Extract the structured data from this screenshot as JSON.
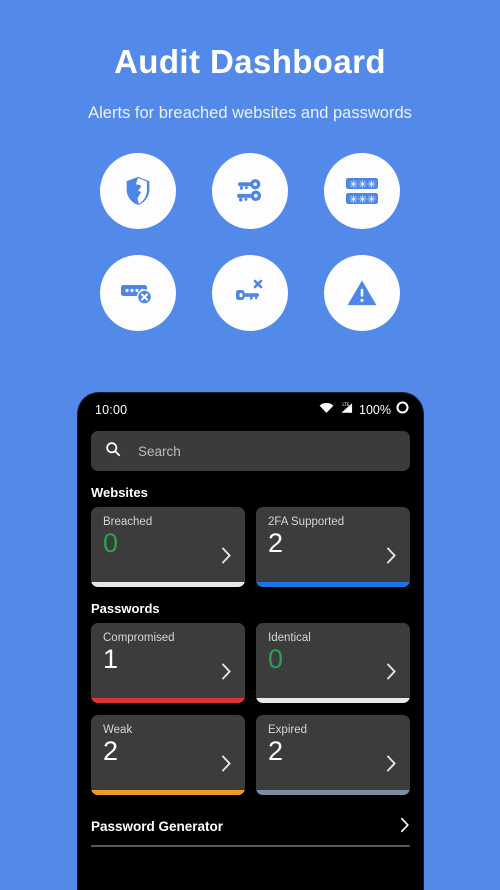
{
  "promo": {
    "title": "Audit Dashboard",
    "subtitle": "Alerts for breached websites and passwords",
    "background_color": "#5389e8",
    "icons": [
      {
        "name": "broken-shield-icon",
        "label": "Broken shield"
      },
      {
        "name": "two-keys-icon",
        "label": "Two factor keys"
      },
      {
        "name": "password-asterisks-icon",
        "label": "Password fields"
      },
      {
        "name": "password-error-icon",
        "label": "Invalid password"
      },
      {
        "name": "key-error-icon",
        "label": "Expired key"
      },
      {
        "name": "warning-triangle-icon",
        "label": "Warning"
      }
    ]
  },
  "phone": {
    "status_bar": {
      "time": "10:00",
      "battery_percent": "100%",
      "icons": [
        "wifi-icon",
        "cellular-lte-icon",
        "battery-icon"
      ]
    },
    "search": {
      "placeholder": "Search",
      "value": "",
      "icon": "search-icon"
    },
    "sections": [
      {
        "title": "Websites",
        "cards": [
          {
            "label": "Breached",
            "value": "0",
            "value_color": "#2e9e52",
            "bar_color": "#e8e8e8"
          },
          {
            "label": "2FA Supported",
            "value": "2",
            "value_color": "#ffffff",
            "bar_color": "#1a73e8"
          }
        ]
      },
      {
        "title": "Passwords",
        "cards": [
          {
            "label": "Compromised",
            "value": "1",
            "value_color": "#ffffff",
            "bar_color": "#e03131"
          },
          {
            "label": "Identical",
            "value": "0",
            "value_color": "#2e9e52",
            "bar_color": "#e8e8e8"
          }
        ]
      },
      {
        "title": "",
        "cards": [
          {
            "label": "Weak",
            "value": "2",
            "value_color": "#ffffff",
            "bar_color": "#f29a28"
          },
          {
            "label": "Expired",
            "value": "2",
            "value_color": "#ffffff",
            "bar_color": "#7a8da3"
          }
        ]
      }
    ],
    "list": [
      {
        "label": "Password Generator"
      }
    ]
  }
}
